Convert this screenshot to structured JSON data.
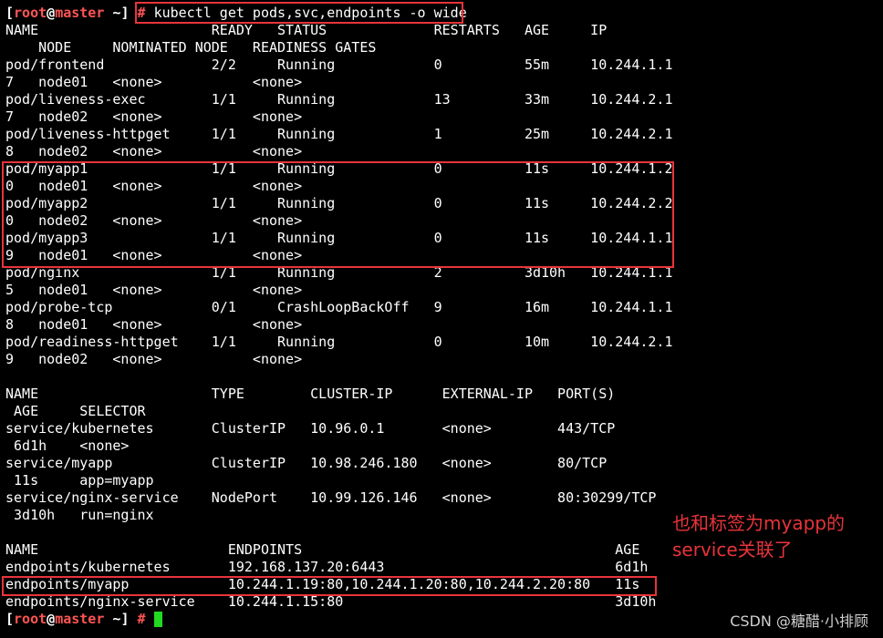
{
  "prompt": {
    "open": "[",
    "user": "root",
    "at": "@",
    "host": "master",
    "path": "~",
    "close": "]",
    "hash": "#"
  },
  "command": "kubectl get pods,svc,endpoints -o wide",
  "output_lines": [
    "NAME                     READY   STATUS             RESTARTS   AGE     IP",
    "    NODE     NOMINATED NODE   READINESS GATES",
    "pod/frontend             2/2     Running            0          55m     10.244.1.1",
    "7   node01   <none>           <none>",
    "pod/liveness-exec        1/1     Running            13         33m     10.244.2.1",
    "7   node02   <none>           <none>",
    "pod/liveness-httpget     1/1     Running            1          25m     10.244.2.1",
    "8   node02   <none>           <none>",
    "pod/myapp1               1/1     Running            0          11s     10.244.1.2",
    "0   node01   <none>           <none>",
    "pod/myapp2               1/1     Running            0          11s     10.244.2.2",
    "0   node02   <none>           <none>",
    "pod/myapp3               1/1     Running            0          11s     10.244.1.1",
    "9   node01   <none>           <none>",
    "pod/nginx                1/1     Running            2          3d10h   10.244.1.1",
    "5   node01   <none>           <none>",
    "pod/probe-tcp            0/1     CrashLoopBackOff   9          16m     10.244.1.1",
    "8   node01   <none>           <none>",
    "pod/readiness-httpget    1/1     Running            0          10m     10.244.2.1",
    "9   node02   <none>           <none>",
    "",
    "NAME                     TYPE        CLUSTER-IP      EXTERNAL-IP   PORT(S)",
    " AGE     SELECTOR",
    "service/kubernetes       ClusterIP   10.96.0.1       <none>        443/TCP",
    " 6d1h    <none>",
    "service/myapp            ClusterIP   10.98.246.180   <none>        80/TCP",
    " 11s     app=myapp",
    "service/nginx-service    NodePort    10.99.126.146   <none>        80:30299/TCP",
    " 3d10h   run=nginx",
    "",
    "NAME                       ENDPOINTS                                      AGE",
    "endpoints/kubernetes       192.168.137.20:6443                            6d1h",
    "endpoints/myapp            10.244.1.19:80,10.244.1.20:80,10.244.2.20:80   11s",
    "endpoints/nginx-service    10.244.1.15:80                                 3d10h"
  ],
  "annotation": {
    "line1": "也和标签为myapp的",
    "line2": "service关联了"
  },
  "watermark": "CSDN @糖醋·小排顾",
  "colors": {
    "background": "#000000",
    "text": "#ffffff",
    "prompt_red": "#ff5555",
    "highlight_box": "#e8343a",
    "cursor": "#21d921"
  }
}
